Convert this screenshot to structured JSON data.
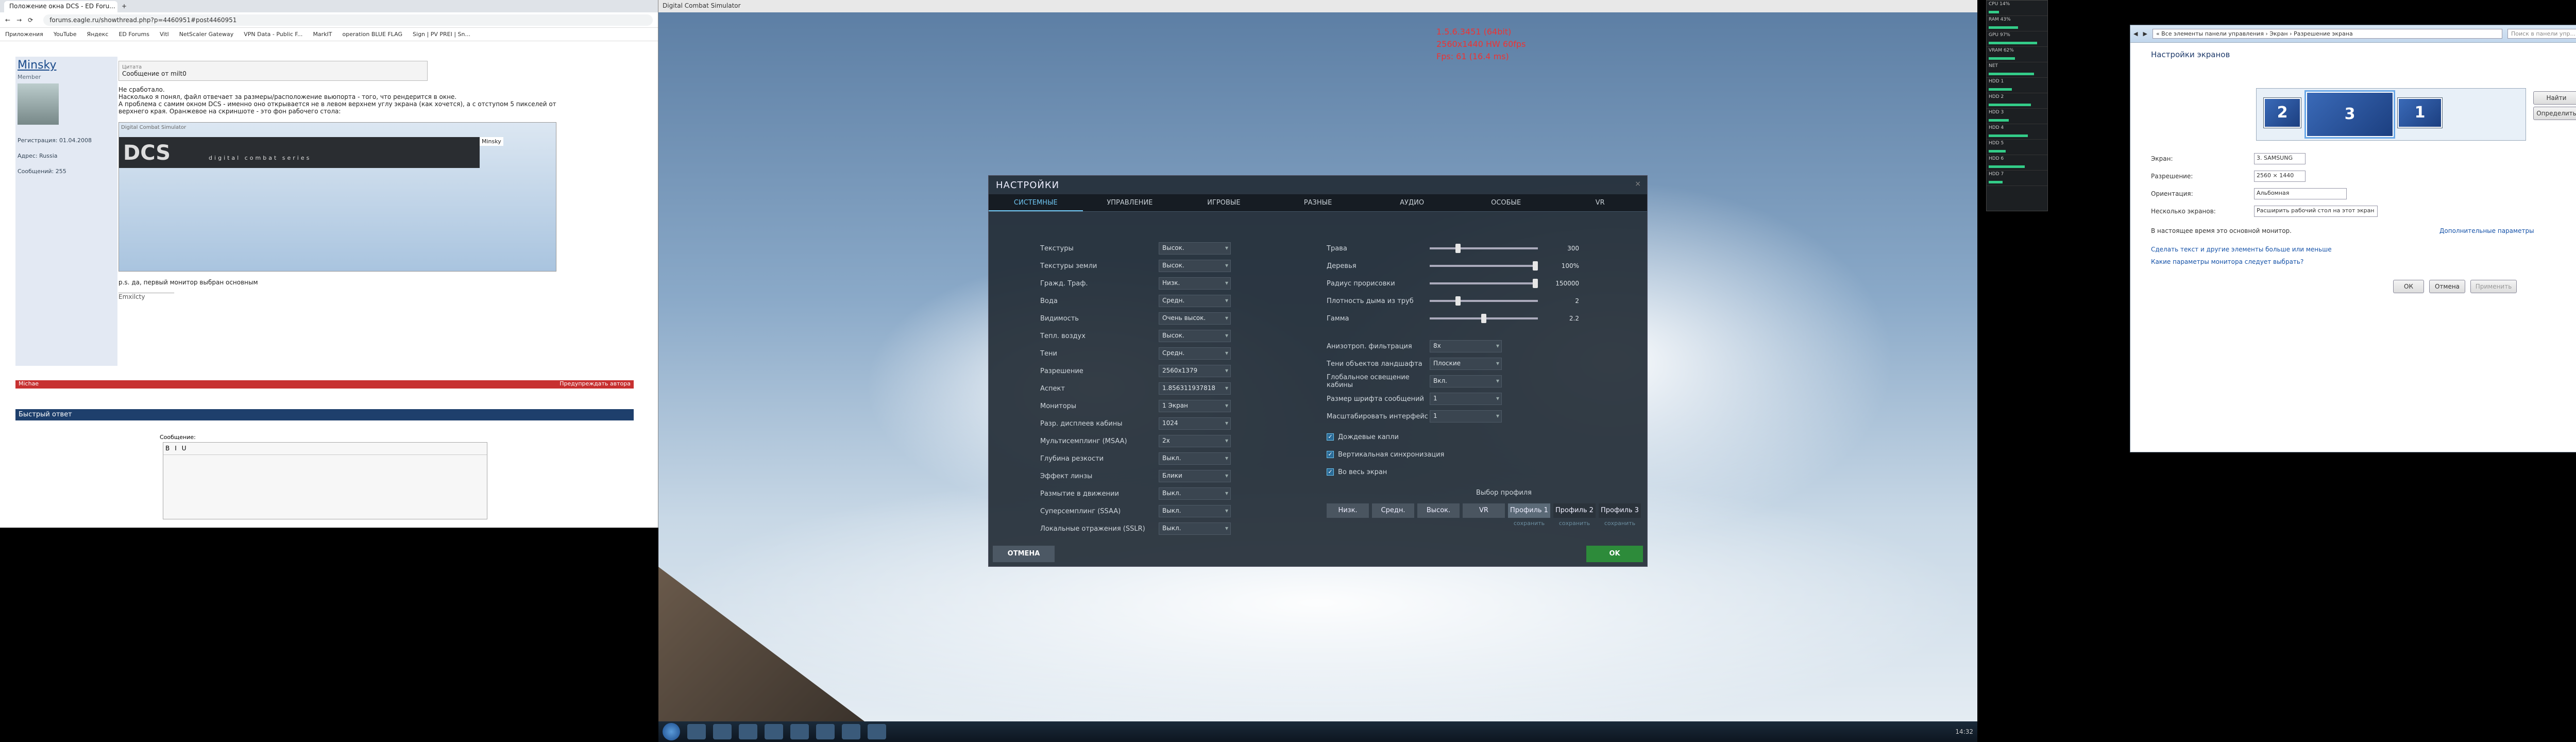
{
  "browser": {
    "tab_title": "Положение окна DCS - ED Foru...",
    "url": "forums.eagle.ru/showthread.php?p=4460951#post4460951",
    "bookmarks": [
      "Приложения",
      "YouTube",
      "Яндекс",
      "ED Forums",
      "Vitl",
      "NetScaler Gateway",
      "VPN Data - Public F...",
      "MarkIT",
      "operation BLUE FLAG",
      "Sign | PV PREI | Sn..."
    ],
    "user": {
      "nick": "Minsky",
      "title": "Member",
      "reg_label": "Регистрация:",
      "reg_value": "01.04.2008",
      "addr_label": "Адрес:",
      "addr_value": "Russia",
      "msgs_label": "Сообщений:",
      "msgs_value": "255"
    },
    "quote_head": "Цитата",
    "quote_text": "Сообщение от milt0",
    "post_lines": [
      "Не сработало.",
      "Насколько я понял, файл отвечает за размеры/расположение вьюпорта - того, что рендерится в окне.",
      "А проблема с самим окном DCS - именно оно открывается не в левом верхнем углу экрана (как хочется), а с отступом 5 пикселей от",
      "верхнего края. Оранжевое на скриншоте - это фон рабочего стола:"
    ],
    "img_title": "Digital Combat Simulator",
    "dcs_logo": "DCS",
    "dcs_sub": "digital combat series",
    "img_nick": "Minsky",
    "post_footer": "p.s. да, первый монитор выбран основным",
    "signature": "__________________",
    "sig_name": "Emxilcty",
    "redbar1": "Michae",
    "redbar1_right": "Предупреждать автора",
    "quick_reply": "Быстрый ответ",
    "reply_label": "Сообщение:"
  },
  "game": {
    "window_title": "Digital Combat Simulator",
    "red_lines": [
      "1.5.6.3451 (64bit)",
      "2560x1440 HW 60fps",
      "Fps: 61 (16.4 ms)"
    ],
    "taskbar_clock": "14:32"
  },
  "dialog": {
    "title": "НАСТРОЙКИ",
    "close": "×",
    "tabs": [
      "СИСТЕМНЫЕ",
      "УПРАВЛЕНИЕ",
      "ИГРОВЫЕ",
      "РАЗНЫЕ",
      "АУДИО",
      "ОСОБЫЕ",
      "VR"
    ],
    "left": [
      {
        "label": "Текстуры",
        "value": "Высок."
      },
      {
        "label": "Текстуры земли",
        "value": "Высок."
      },
      {
        "label": "Гражд. Траф.",
        "value": "Низк."
      },
      {
        "label": "Вода",
        "value": "Средн."
      },
      {
        "label": "Видимость",
        "value": "Очень высок."
      },
      {
        "label": "Тепл. воздух",
        "value": "Высок."
      },
      {
        "label": "Тени",
        "value": "Средн."
      },
      {
        "label": "Разрешение",
        "value": "2560x1379"
      },
      {
        "label": "Аспект",
        "value": "1.856311937818"
      },
      {
        "label": "Мониторы",
        "value": "1 Экран"
      },
      {
        "label": "Разр. дисплеев кабины",
        "value": "1024"
      },
      {
        "label": "Мультисемплинг (MSAA)",
        "value": "2x"
      },
      {
        "label": "Глубина резкости",
        "value": "Выкл."
      },
      {
        "label": "Эффект линзы",
        "value": "Блики"
      },
      {
        "label": "Размытие в движении",
        "value": "Выкл."
      },
      {
        "label": "Суперсемплинг (SSAA)",
        "value": "Выкл."
      },
      {
        "label": "Локальные отражения (SSLR)",
        "value": "Выкл."
      }
    ],
    "sliders": [
      {
        "label": "Трава",
        "value": "300",
        "pos": 0.25
      },
      {
        "label": "Деревья",
        "value": "100%",
        "pos": 1.0
      },
      {
        "label": "Радиус прорисовки",
        "value": "150000",
        "pos": 1.0
      },
      {
        "label": "Плотность дыма из труб",
        "value": "2",
        "pos": 0.25
      },
      {
        "label": "Гамма",
        "value": "2.2",
        "pos": 0.5
      }
    ],
    "right_selects": [
      {
        "label": "Анизотроп. фильтрация",
        "value": "8x"
      },
      {
        "label": "Тени объектов ландшафта",
        "value": "Плоские"
      },
      {
        "label": "Глобальное освещение кабины",
        "value": "Вкл."
      },
      {
        "label": "Размер шрифта сообщений",
        "value": "1"
      },
      {
        "label": "Масштабировать интерфейс",
        "value": "1"
      }
    ],
    "checks": [
      {
        "label": "Дождевые капли",
        "checked": true
      },
      {
        "label": "Вертикальная синхронизация",
        "checked": true
      },
      {
        "label": "Во весь экран",
        "checked": true
      }
    ],
    "preset_title": "Выбор профиля",
    "presets": [
      "Низк.",
      "Средн.",
      "Высок.",
      "VR",
      "Профиль 1",
      "Профиль 2",
      "Профиль 3"
    ],
    "save_links": [
      "сохранить",
      "сохранить",
      "сохранить"
    ],
    "cancel": "ОТМЕНА",
    "ok": "OK"
  },
  "widget": {
    "rows": [
      "CPU 14%",
      "RAM 43%",
      "GPU 97%",
      "VRAM 62%",
      "NET",
      "HDD 1",
      "HDD 2",
      "HDD 3",
      "HDD 4",
      "HDD 5",
      "HDD 6",
      "HDD 7"
    ]
  },
  "win7": {
    "breadcrumb": "« Все элементы панели управления › Экран › Разрешение экрана",
    "search_placeholder": "Поиск в панели упр...",
    "heading": "Настройки экранов",
    "mon_labels": [
      "2",
      "3",
      "1"
    ],
    "find_btn": "Найти",
    "identify_btn": "Определить",
    "screen_label": "Экран:",
    "screen_value": "3. SAMSUNG",
    "res_label": "Разрешение:",
    "res_value": "2560 × 1440",
    "orient_label": "Ориентация:",
    "orient_value": "Альбомная",
    "multi_label": "Несколько экранов:",
    "multi_value": "Расширить рабочий стол на этот экран",
    "primary_text": "В настоящее время это основной монитор.",
    "advanced_link": "Дополнительные параметры",
    "link1": "Сделать текст и другие элементы больше или меньше",
    "link2": "Какие параметры монитора следует выбрать?",
    "ok": "ОК",
    "cancel": "Отмена",
    "apply": "Применить"
  }
}
